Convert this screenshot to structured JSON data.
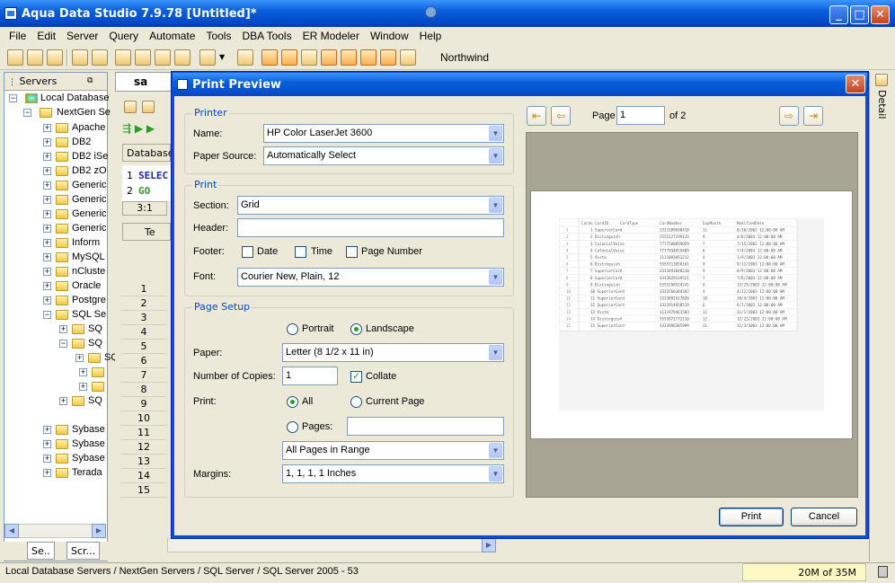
{
  "window": {
    "title": "Aqua Data Studio 7.9.78 [Untitled]*"
  },
  "menu": [
    "File",
    "Edit",
    "Server",
    "Query",
    "Automate",
    "Tools",
    "DBA Tools",
    "ER Modeler",
    "Window",
    "Help"
  ],
  "toolbar": {
    "database": "Northwind"
  },
  "servers_panel": {
    "title": "Servers",
    "tree": [
      "Local Database",
      "NextGen Se",
      "Apache",
      "DB2",
      "DB2 iSe",
      "DB2 zO",
      "Generic",
      "Generic",
      "Generic",
      "Generic",
      "Inform",
      "MySQL",
      "nCluste",
      "Oracle",
      "Postgre",
      "SQL Se",
      "SQ",
      "SQ",
      "SQ",
      "SQ",
      "Sybase",
      "Sybase",
      "Sybase",
      "Terada"
    ],
    "tabs": [
      "Se..",
      "Scr..."
    ]
  },
  "editor": {
    "tab": "sa",
    "db_label": "Database",
    "sql": [
      "SELEC",
      "GO"
    ],
    "line_nums": [
      "1",
      "2"
    ],
    "cursor": "3:1",
    "results_tab": "Te",
    "rows": [
      "1",
      "2",
      "3",
      "4",
      "5",
      "6",
      "7",
      "8",
      "9",
      "10",
      "11",
      "12",
      "13",
      "14",
      "15"
    ]
  },
  "detail_label": "Detail",
  "status": {
    "path": "Local Database Servers / NextGen Servers / SQL Server / SQL Server 2005 - 53",
    "memory": "20M of 35M"
  },
  "dialog": {
    "title": "Print Preview",
    "printer": {
      "group": "Printer",
      "name_label": "Name:",
      "name": "HP Color LaserJet 3600",
      "source_label": "Paper Source:",
      "source": "Automatically Select"
    },
    "print": {
      "group": "Print",
      "section_label": "Section:",
      "section": "Grid",
      "header_label": "Header:",
      "header": "",
      "footer_label": "Footer:",
      "date": "Date",
      "time": "Time",
      "page_number": "Page Number",
      "font_label": "Font:",
      "font": "Courier New, Plain, 12"
    },
    "setup": {
      "group": "Page Setup",
      "portrait": "Portrait",
      "landscape": "Landscape",
      "orientation": "Landscape",
      "paper_label": "Paper:",
      "paper": "Letter (8 1/2 x 11 in)",
      "copies_label": "Number of Copies:",
      "copies": "1",
      "collate": "Collate",
      "collate_checked": true,
      "print_label": "Print:",
      "all": "All",
      "current_page": "Current Page",
      "pages": "Pages:",
      "pages_value": "",
      "range": "All Pages in Range",
      "margins_label": "Margins:",
      "margins": "1, 1, 1, 1 Inches"
    },
    "nav": {
      "page_label": "Page",
      "page": "1",
      "of": "of 2"
    },
    "buttons": {
      "print": "Print",
      "cancel": "Cancel"
    },
    "preview_headers": [
      "Cards_CardID",
      "CardType",
      "CardNumber",
      "ExpMonth",
      "ModifiedDate"
    ],
    "preview_rows": [
      [
        "1",
        "1",
        "SuperiorCard",
        "3333189698418",
        "11",
        "8/30/2003 12:00:00 AM"
      ],
      [
        "2",
        "2",
        "Distinguish",
        "5555127299132",
        "9",
        "4/8/2003 12:00:00 AM"
      ],
      [
        "3",
        "3",
        "ColonialVoice",
        "7777580859059",
        "7",
        "7/15/2003 12:00:00 AM"
      ],
      [
        "4",
        "4",
        "ColonialVoice",
        "7777934819409",
        "6",
        "7/4/2003 12:00:00 AM"
      ],
      [
        "5",
        "5",
        "Vista",
        "1111093852212",
        "4",
        "1/9/2003 12:00:00 AM"
      ],
      [
        "6",
        "6",
        "Distinguish",
        "5555713050101",
        "9",
        "9/11/2003 12:00:00 AM"
      ],
      [
        "7",
        "7",
        "SuperiorCard",
        "3333493848238",
        "9",
        "8/9/2003 12:00:00 AM"
      ],
      [
        "8",
        "8",
        "SuperiorCard",
        "3333829139521",
        "7",
        "7/6/2003 12:00:00 AM"
      ],
      [
        "9",
        "9",
        "Distinguish",
        "5555298524241",
        "9",
        "12/25/2003 12:00:00 AM"
      ],
      [
        "10",
        "10",
        "SuperiorCard",
        "3333266384392",
        "4",
        "4/22/2003 12:00:00 AM"
      ],
      [
        "11",
        "11",
        "SuperiorCard",
        "3333892417826",
        "10",
        "10/4/2003 12:00:00 AM"
      ],
      [
        "12",
        "12",
        "SuperiorCard",
        "3333914958519",
        "6",
        "6/7/2003 12:00:00 AM"
      ],
      [
        "13",
        "13",
        "Vista",
        "1111979461503",
        "11",
        "11/1/2003 12:00:00 AM"
      ],
      [
        "14",
        "14",
        "Distinguish",
        "5555872772110",
        "12",
        "12/23/2003 12:00:00 AM"
      ],
      [
        "15",
        "15",
        "SuperiorCard",
        "3333996385999",
        "11",
        "11/3/2003 12:00:00 AM"
      ]
    ]
  }
}
